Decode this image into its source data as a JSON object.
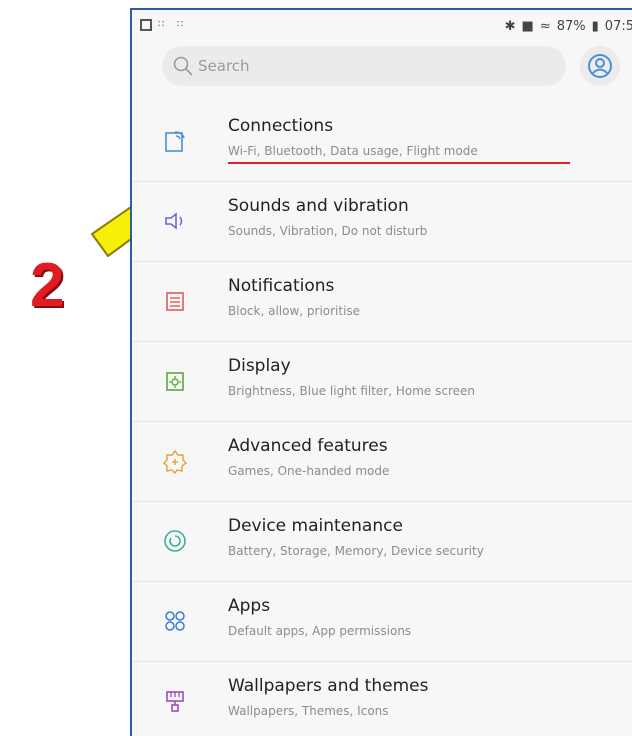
{
  "status_bar": {
    "battery": "87%",
    "time": "07:5"
  },
  "search": {
    "placeholder": "Search"
  },
  "annotation": {
    "step": "2",
    "arrow_color": "#f5ef0a",
    "underline_color": "#e0202a"
  },
  "settings": {
    "items": [
      {
        "title": "Connections",
        "subtitle": "Wi-Fi, Bluetooth, Data usage, Flight mode",
        "icon": "connections-icon",
        "color": "#4a8fd6"
      },
      {
        "title": "Sounds and vibration",
        "subtitle": "Sounds, Vibration, Do not disturb",
        "icon": "volume-icon",
        "color": "#6a6ad6"
      },
      {
        "title": "Notifications",
        "subtitle": "Block, allow, prioritise",
        "icon": "notifications-icon",
        "color": "#e05a5a"
      },
      {
        "title": "Display",
        "subtitle": "Brightness, Blue light filter, Home screen",
        "icon": "display-icon",
        "color": "#5aa83a"
      },
      {
        "title": "Advanced features",
        "subtitle": "Games, One-handed mode",
        "icon": "advanced-features-icon",
        "color": "#e8a030"
      },
      {
        "title": "Device maintenance",
        "subtitle": "Battery, Storage, Memory, Device security",
        "icon": "device-maintenance-icon",
        "color": "#3ab09a"
      },
      {
        "title": "Apps",
        "subtitle": "Default apps, App permissions",
        "icon": "apps-icon",
        "color": "#3a7ad6"
      },
      {
        "title": "Wallpapers and themes",
        "subtitle": "Wallpapers, Themes, Icons",
        "icon": "wallpapers-icon",
        "color": "#a04ac0"
      }
    ]
  }
}
